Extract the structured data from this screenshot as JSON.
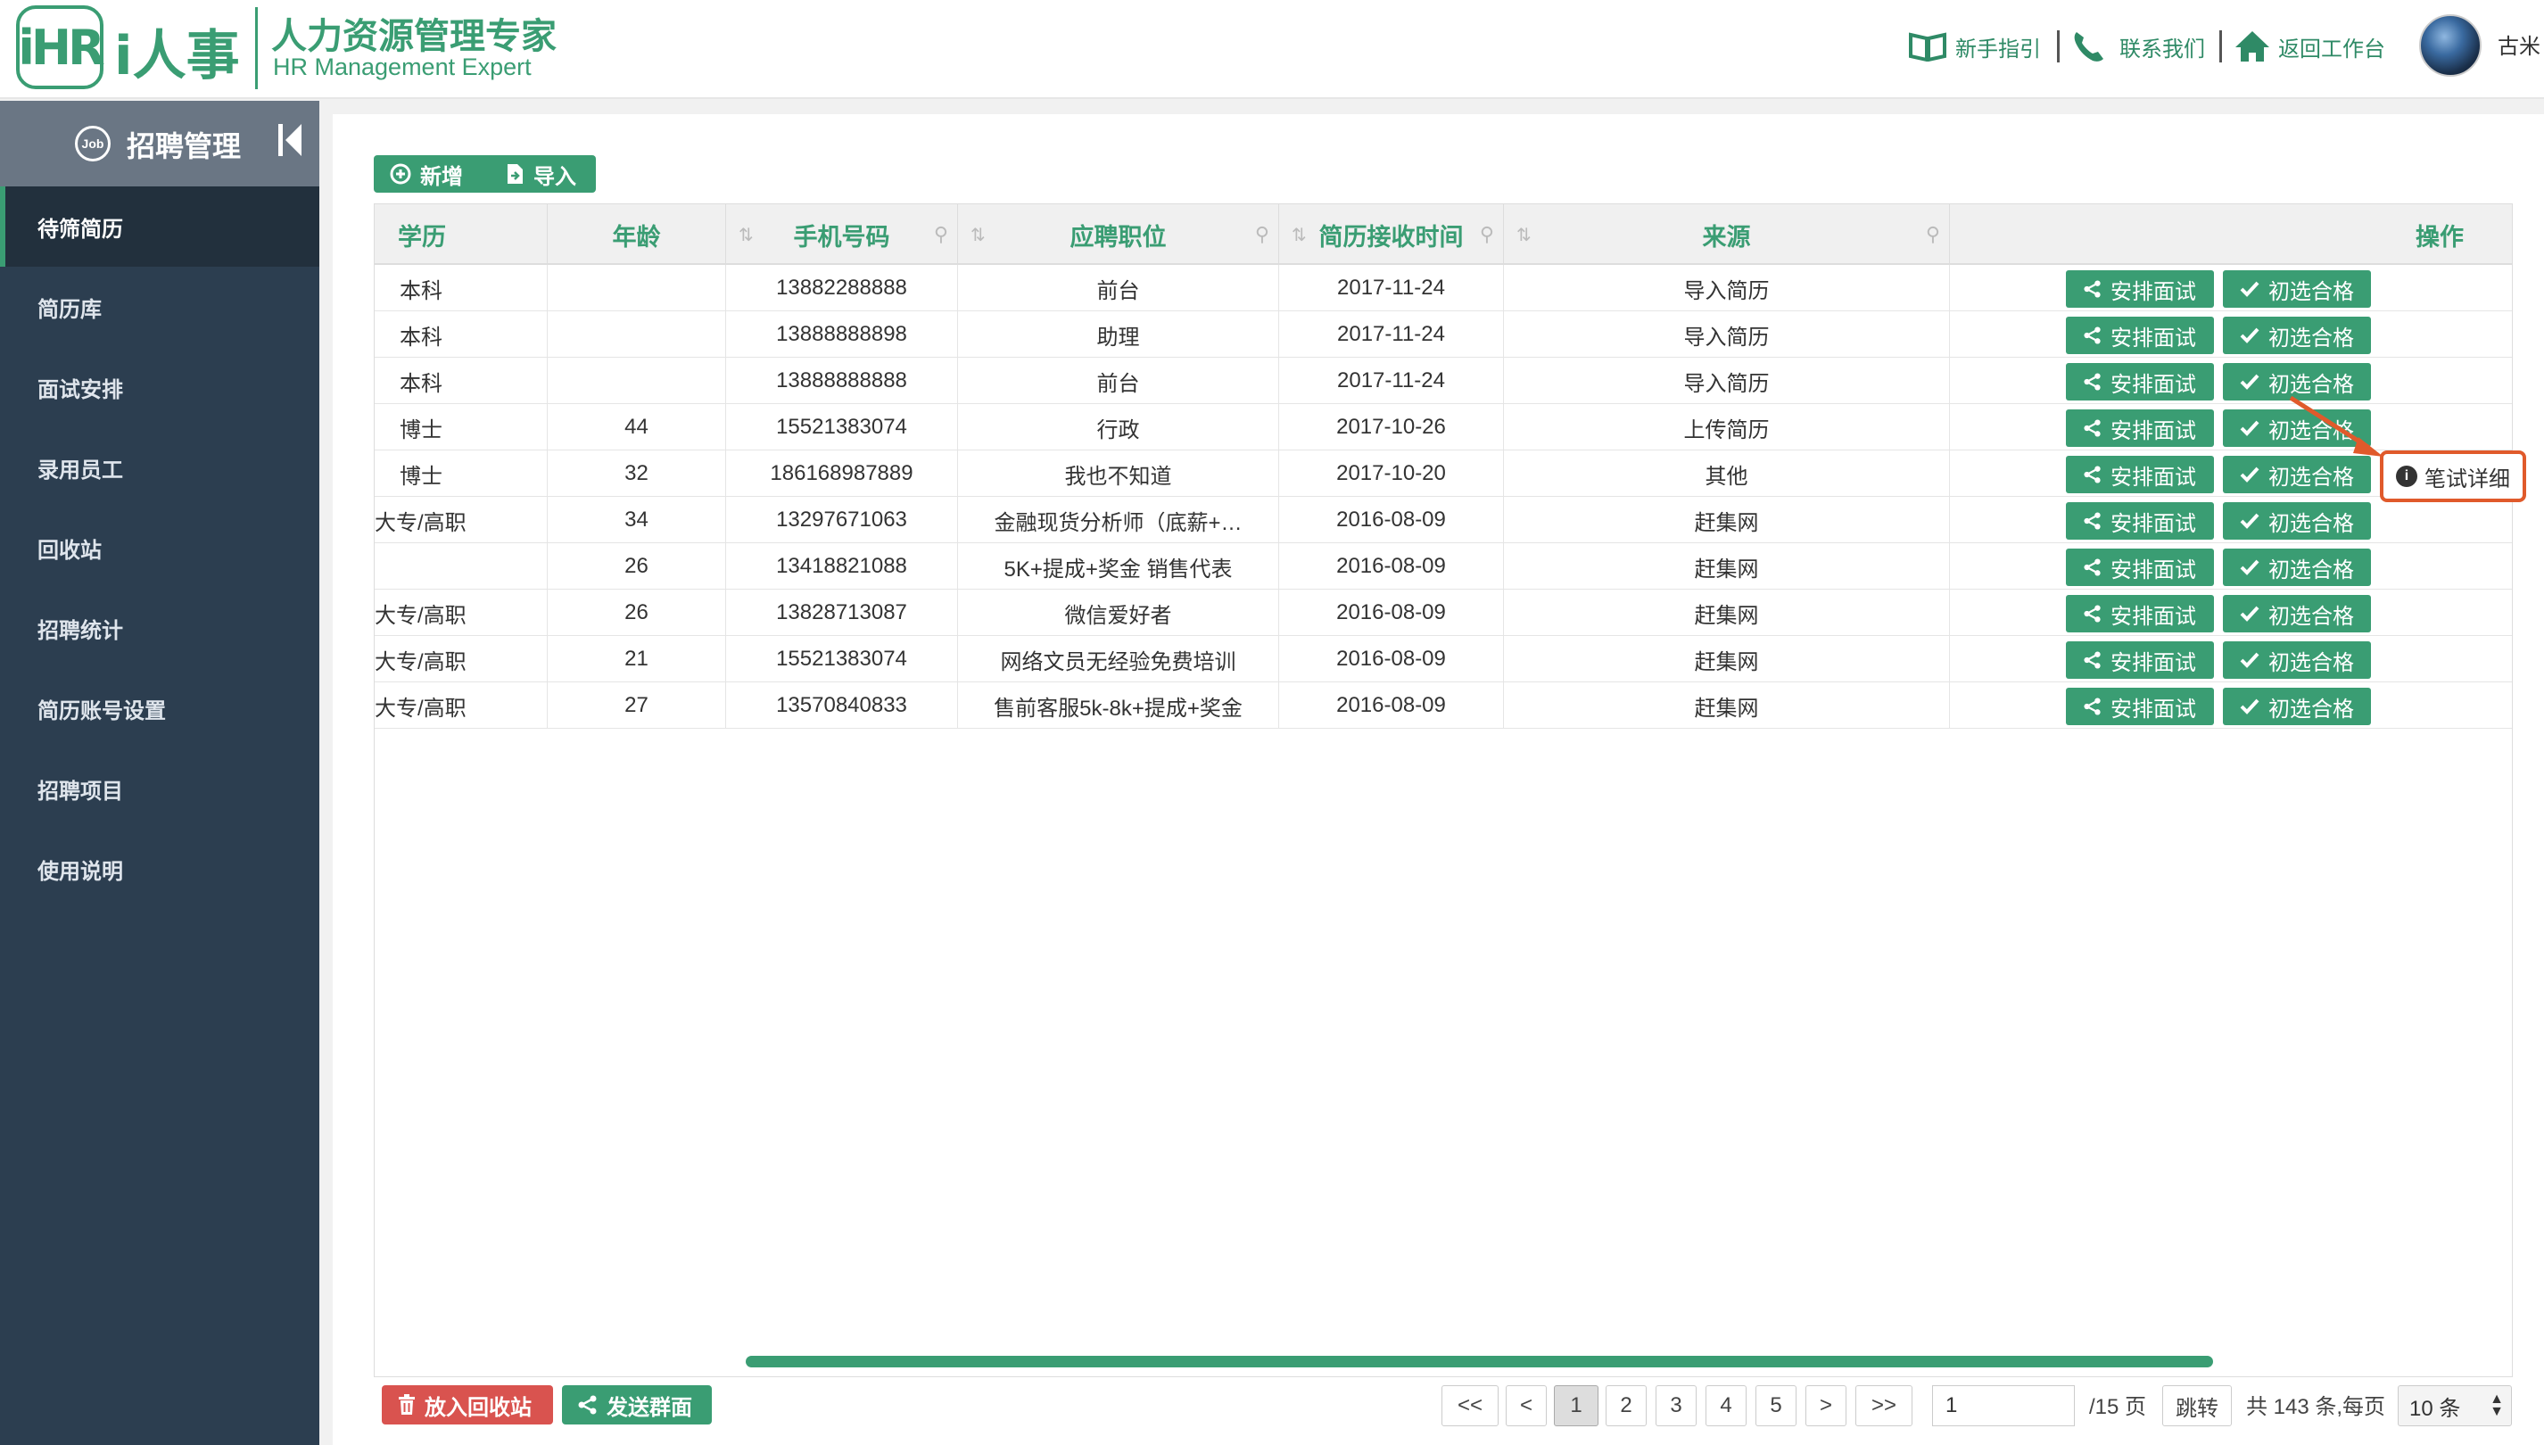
{
  "header": {
    "logo_mark": "iHR",
    "logo_name": "i人事",
    "title": "人力资源管理专家",
    "subtitle": "HR Management Expert",
    "nav": [
      {
        "label": "新手指引",
        "icon": "book-icon"
      },
      {
        "label": "联系我们",
        "icon": "phone-icon"
      },
      {
        "label": "返回工作台",
        "icon": "home-icon"
      }
    ],
    "username": "古米"
  },
  "sidebar": {
    "title": "招聘管理",
    "items": [
      {
        "label": "待筛简历",
        "active": true
      },
      {
        "label": "简历库"
      },
      {
        "label": "面试安排"
      },
      {
        "label": "录用员工"
      },
      {
        "label": "回收站"
      },
      {
        "label": "招聘统计"
      },
      {
        "label": "简历账号设置"
      },
      {
        "label": "招聘项目"
      },
      {
        "label": "使用说明"
      }
    ]
  },
  "toolbar": {
    "add_label": "新增",
    "import_label": "导入"
  },
  "table": {
    "columns": [
      "学历",
      "年龄",
      "手机号码",
      "应聘职位",
      "简历接收时间",
      "来源",
      "操作"
    ],
    "rows": [
      {
        "edu": "本科",
        "age": "",
        "phone": "13882288888",
        "position": "前台",
        "date": "2017-11-24",
        "source": "导入简历"
      },
      {
        "edu": "本科",
        "age": "",
        "phone": "13888888898",
        "position": "助理",
        "date": "2017-11-24",
        "source": "导入简历"
      },
      {
        "edu": "本科",
        "age": "",
        "phone": "13888888888",
        "position": "前台",
        "date": "2017-11-24",
        "source": "导入简历"
      },
      {
        "edu": "博士",
        "age": "44",
        "phone": "15521383074",
        "position": "行政",
        "date": "2017-10-26",
        "source": "上传简历"
      },
      {
        "edu": "博士",
        "age": "32",
        "phone": "186168987889",
        "position": "我也不知道",
        "date": "2017-10-20",
        "source": "其他"
      },
      {
        "edu": "大专/高职",
        "age": "34",
        "phone": "13297671063",
        "position": "金融现货分析师（底薪+…",
        "date": "2016-08-09",
        "source": "赶集网"
      },
      {
        "edu": "",
        "age": "26",
        "phone": "13418821088",
        "position": "5K+提成+奖金 销售代表",
        "date": "2016-08-09",
        "source": "赶集网"
      },
      {
        "edu": "大专/高职",
        "age": "26",
        "phone": "13828713087",
        "position": "微信爱好者",
        "date": "2016-08-09",
        "source": "赶集网"
      },
      {
        "edu": "大专/高职",
        "age": "21",
        "phone": "15521383074",
        "position": "网络文员无经验免费培训",
        "date": "2016-08-09",
        "source": "赶集网"
      },
      {
        "edu": "大专/高职",
        "age": "27",
        "phone": "13570840833",
        "position": "售前客服5k-8k+提成+奖金",
        "date": "2016-08-09",
        "source": "赶集网"
      }
    ],
    "action_schedule": "安排面试",
    "action_pass": "初选合格"
  },
  "callout": {
    "label": "笔试详细"
  },
  "footer": {
    "recycle_label": "放入回收站",
    "group_label": "发送群面",
    "pages": [
      "1",
      "2",
      "3",
      "4",
      "5"
    ],
    "first": "<<",
    "prev": "<",
    "next": ">",
    "last": ">>",
    "page_input": "1",
    "total_pages": "/15 页",
    "jump_label": "跳转",
    "total_info": "共 143 条,每页",
    "page_size": "10 条"
  },
  "colors": {
    "accent": "#3a9d73",
    "sidebar_bg": "#2c3e50",
    "danger": "#d9534f",
    "callout_border": "#e05a2b"
  }
}
